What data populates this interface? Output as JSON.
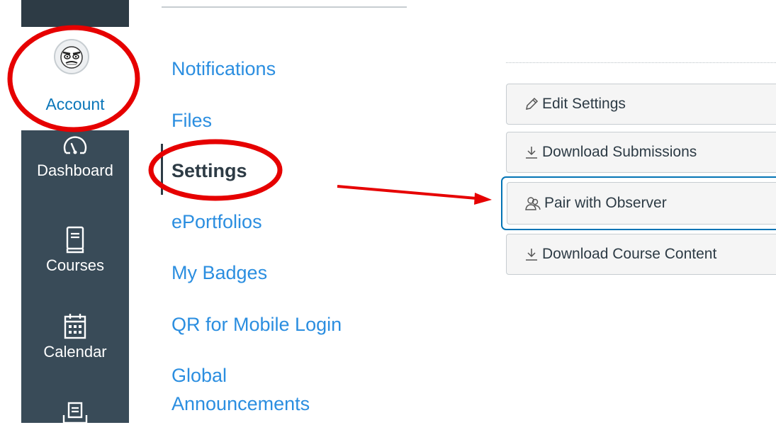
{
  "global_nav": {
    "account_label": "Account",
    "items": [
      {
        "label": "Dashboard",
        "icon": "dashboard-icon"
      },
      {
        "label": "Courses",
        "icon": "courses-icon"
      },
      {
        "label": "Calendar",
        "icon": "calendar-icon"
      },
      {
        "label": "",
        "icon": "inbox-icon"
      }
    ]
  },
  "account_nav": {
    "items": [
      {
        "label": "Notifications"
      },
      {
        "label": "Files"
      },
      {
        "label": "Settings",
        "active": true
      },
      {
        "label": "ePortfolios"
      },
      {
        "label": "My Badges"
      },
      {
        "label": "QR for Mobile Login"
      },
      {
        "label": "Global"
      },
      {
        "label": "Announcements"
      }
    ]
  },
  "side_buttons": [
    {
      "label": "Edit Settings",
      "icon": "pencil-icon"
    },
    {
      "label": "Download Submissions",
      "icon": "download-icon"
    },
    {
      "label": "Pair with Observer",
      "icon": "observer-icon",
      "focused": true
    },
    {
      "label": "Download Course Content",
      "icon": "download-icon"
    }
  ],
  "colors": {
    "nav_bg": "#394b58",
    "link": "#2b8ee0",
    "annotation": "#e60000",
    "focus_ring": "#0374b5"
  }
}
